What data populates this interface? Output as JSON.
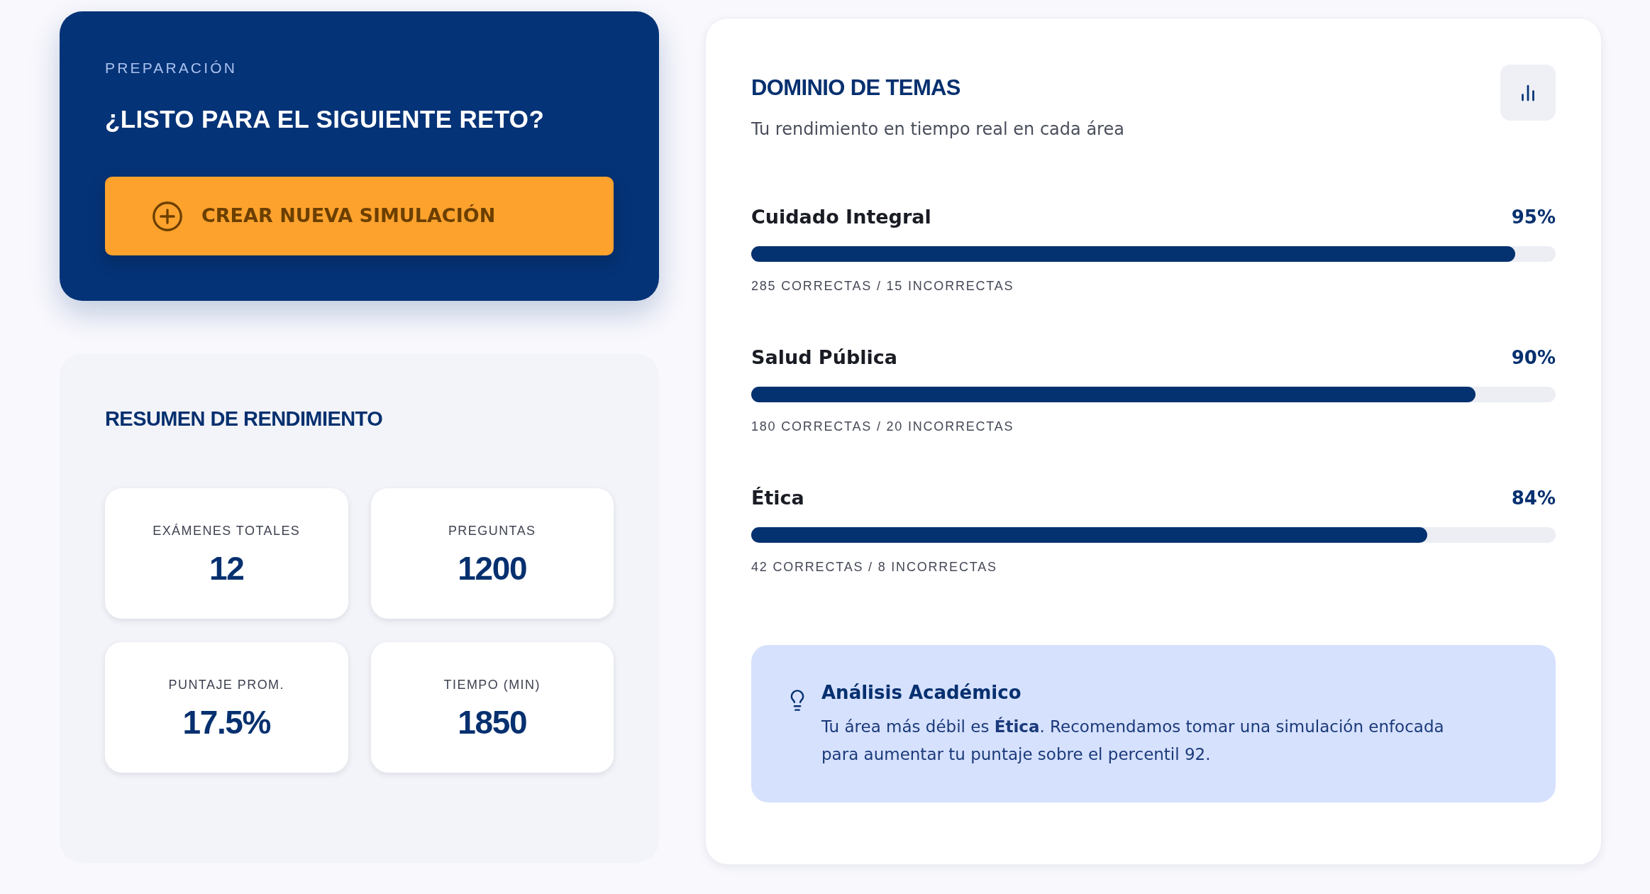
{
  "hero": {
    "eyebrow": "PREPARACIÓN",
    "title": "¿LISTO PARA EL SIGUIENTE RETO?",
    "button": {
      "label": "CREAR NUEVA SIMULACIÓN"
    }
  },
  "summary": {
    "title": "RESUMEN DE RENDIMIENTO",
    "stats": [
      {
        "label": "EXÁMENES TOTALES",
        "value": "12"
      },
      {
        "label": "PREGUNTAS",
        "value": "1200"
      },
      {
        "label": "PUNTAJE PROM.",
        "value": "17.5%"
      },
      {
        "label": "TIEMPO (MIN)",
        "value": "1850"
      }
    ]
  },
  "mastery": {
    "title": "DOMINIO DE TEMAS",
    "subtitle": "Tu rendimiento en tiempo real en cada área",
    "topics": [
      {
        "name": "Cuidado Integral",
        "percent": "95%",
        "level": 0.95,
        "caption": "285 CORRECTAS / 15 INCORRECTAS"
      },
      {
        "name": "Salud Pública",
        "percent": "90%",
        "level": 0.9,
        "caption": "180 CORRECTAS / 20 INCORRECTAS"
      },
      {
        "name": "Ética",
        "percent": "84%",
        "level": 0.84,
        "caption": "42 CORRECTAS / 8 INCORRECTAS"
      }
    ],
    "insight": {
      "title": "Análisis Académico",
      "text": "Tu área más débil es **Ética**. Recomendamos tomar una simulación enfocada para aumentar tu puntaje sobre el percentil 92."
    }
  }
}
